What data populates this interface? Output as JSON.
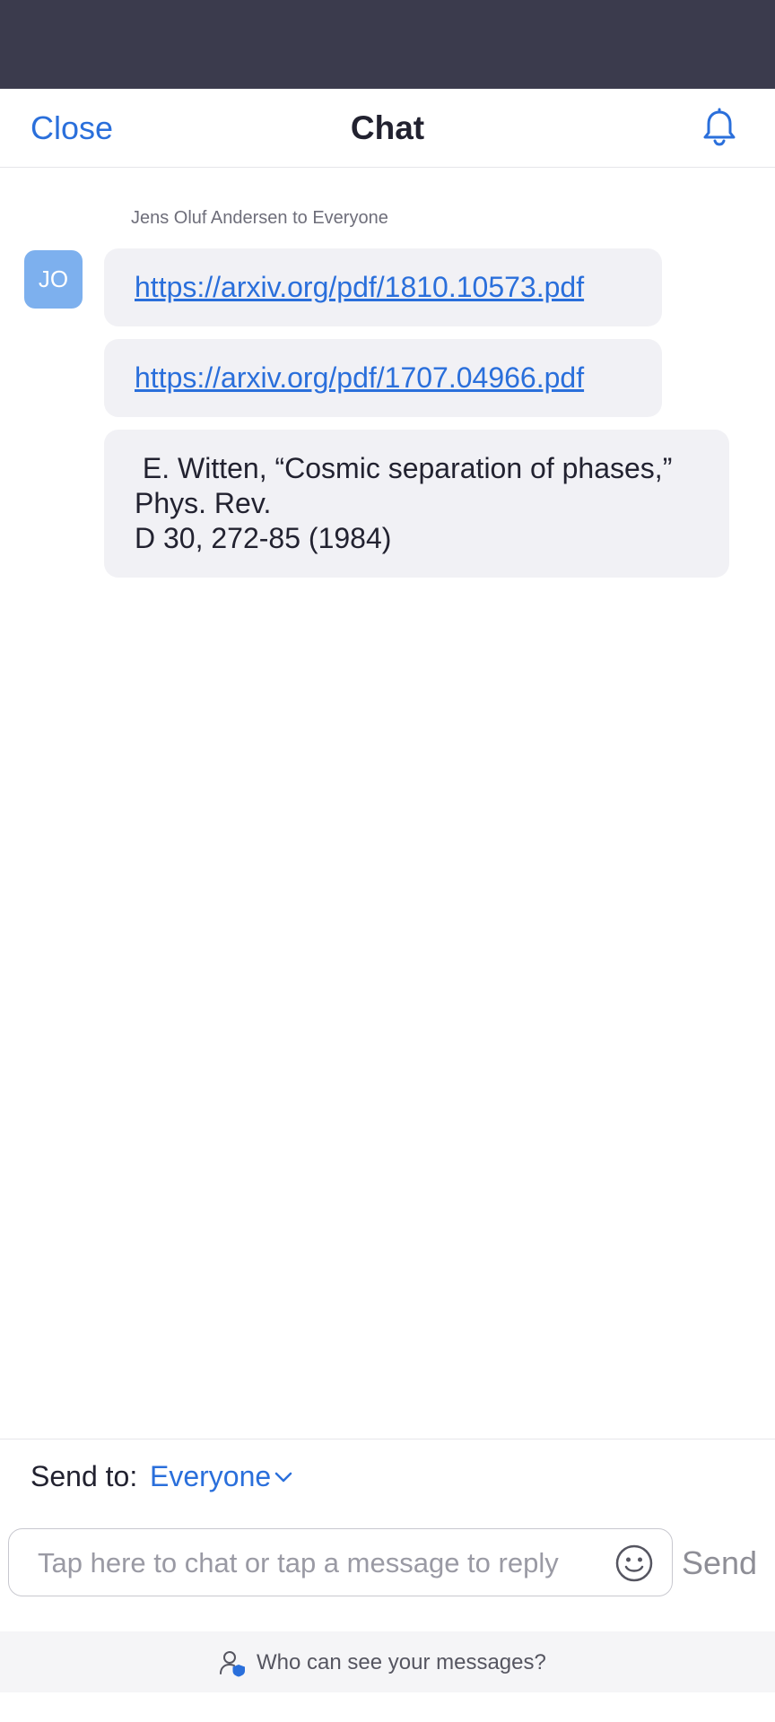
{
  "header": {
    "close_label": "Close",
    "title": "Chat",
    "bell_icon": "bell-icon"
  },
  "message_group": {
    "sender_line": "Jens Oluf Andersen to Everyone",
    "avatar_initials": "JO",
    "messages": [
      {
        "type": "link",
        "text": "https://arxiv.org/pdf/1810.10573.pdf"
      },
      {
        "type": "link",
        "text": "https://arxiv.org/pdf/1707.04966.pdf"
      },
      {
        "type": "text",
        "lines": [
          " E. Witten, “Cosmic separation of phases,”",
          "Phys. Rev.",
          "D 30, 272-85 (1984)"
        ]
      }
    ]
  },
  "composer": {
    "send_to_label": "Send to:",
    "send_to_value": "Everyone",
    "chevron_icon": "chevron-down-icon",
    "input_placeholder": "Tap here to chat or tap a message to reply",
    "input_value": "",
    "emoji_icon": "emoji-icon",
    "send_label": "Send"
  },
  "privacy": {
    "icon": "user-shield-icon",
    "text": "Who can see your messages?"
  },
  "colors": {
    "accent": "#2a6fdb",
    "status_bar": "#3b3b4d",
    "avatar_bg": "#7db0ee",
    "bubble_bg": "#f1f1f5"
  }
}
